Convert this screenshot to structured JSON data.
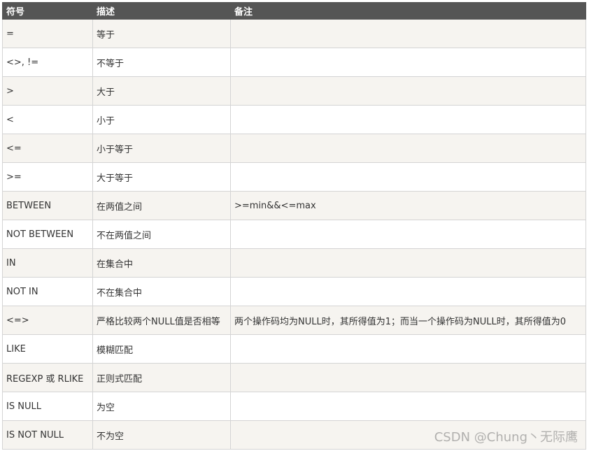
{
  "table": {
    "headers": [
      "符号",
      "描述",
      "备注"
    ],
    "rows": [
      [
        "=",
        "等于",
        ""
      ],
      [
        "<>, !=",
        "不等于",
        ""
      ],
      [
        ">",
        "大于",
        ""
      ],
      [
        "<",
        "小于",
        ""
      ],
      [
        "<=",
        "小于等于",
        ""
      ],
      [
        ">=",
        "大于等于",
        ""
      ],
      [
        "BETWEEN",
        "在两值之间",
        ">=min&&<=max"
      ],
      [
        "NOT BETWEEN",
        "不在两值之间",
        ""
      ],
      [
        "IN",
        "在集合中",
        ""
      ],
      [
        "NOT IN",
        "不在集合中",
        ""
      ],
      [
        "<=>",
        "严格比较两个NULL值是否相等",
        "两个操作码均为NULL时，其所得值为1；而当一个操作码为NULL时，其所得值为0"
      ],
      [
        "LIKE",
        "模糊匹配",
        ""
      ],
      [
        "REGEXP 或 RLIKE",
        "正则式匹配",
        ""
      ],
      [
        "IS NULL",
        "为空",
        ""
      ],
      [
        "IS NOT NULL",
        "不为空",
        ""
      ]
    ]
  },
  "watermark": "CSDN @Chung丶无际鹰"
}
